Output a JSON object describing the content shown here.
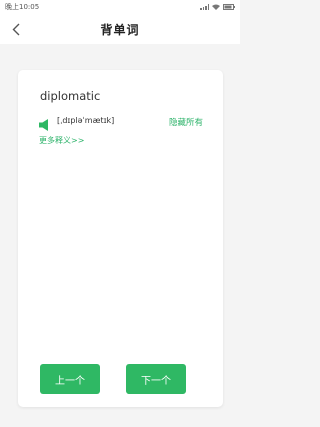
{
  "status_bar": {
    "time": "晚上10:05",
    "icons": [
      "signal-icon",
      "wifi-icon",
      "battery-icon"
    ]
  },
  "header": {
    "title": "背单词",
    "back_icon": "chevron-left-icon"
  },
  "card": {
    "word": "diplomatic",
    "phonetic": "[ˌdɪpləˈmætɪk]",
    "speaker_icon": "speaker-icon",
    "hide_all_label": "隐藏所有",
    "more_meanings_label": "更多释义>>",
    "prev_label": "上一个",
    "next_label": "下一个"
  },
  "colors": {
    "accent": "#2fb864",
    "link": "#2db36a",
    "background": "#f4f4f4",
    "card": "#ffffff"
  }
}
